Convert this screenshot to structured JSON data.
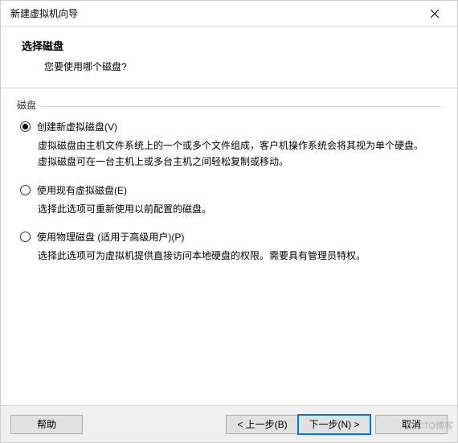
{
  "titlebar": {
    "title": "新建虚拟机向导"
  },
  "header": {
    "heading": "选择磁盘",
    "sub": "您要使用哪个磁盘?"
  },
  "fieldset": {
    "label": "磁盘"
  },
  "options": [
    {
      "label": "创建新虚拟磁盘(V)",
      "desc": "虚拟磁盘由主机文件系统上的一个或多个文件组成，客户机操作系统会将其视为单个硬盘。虚拟磁盘可在一台主机上或多台主机之间轻松复制或移动。",
      "checked": true
    },
    {
      "label": "使用现有虚拟磁盘(E)",
      "desc": "选择此选项可重新使用以前配置的磁盘。",
      "checked": false
    },
    {
      "label": "使用物理磁盘 (适用于高级用户)(P)",
      "desc": "选择此选项可为虚拟机提供直接访问本地硬盘的权限。需要具有管理员特权。",
      "checked": false
    }
  ],
  "footer": {
    "help": "帮助",
    "back": "< 上一步(B)",
    "next": "下一步(N) >",
    "cancel": "取消"
  },
  "watermark": "51CTO博客"
}
